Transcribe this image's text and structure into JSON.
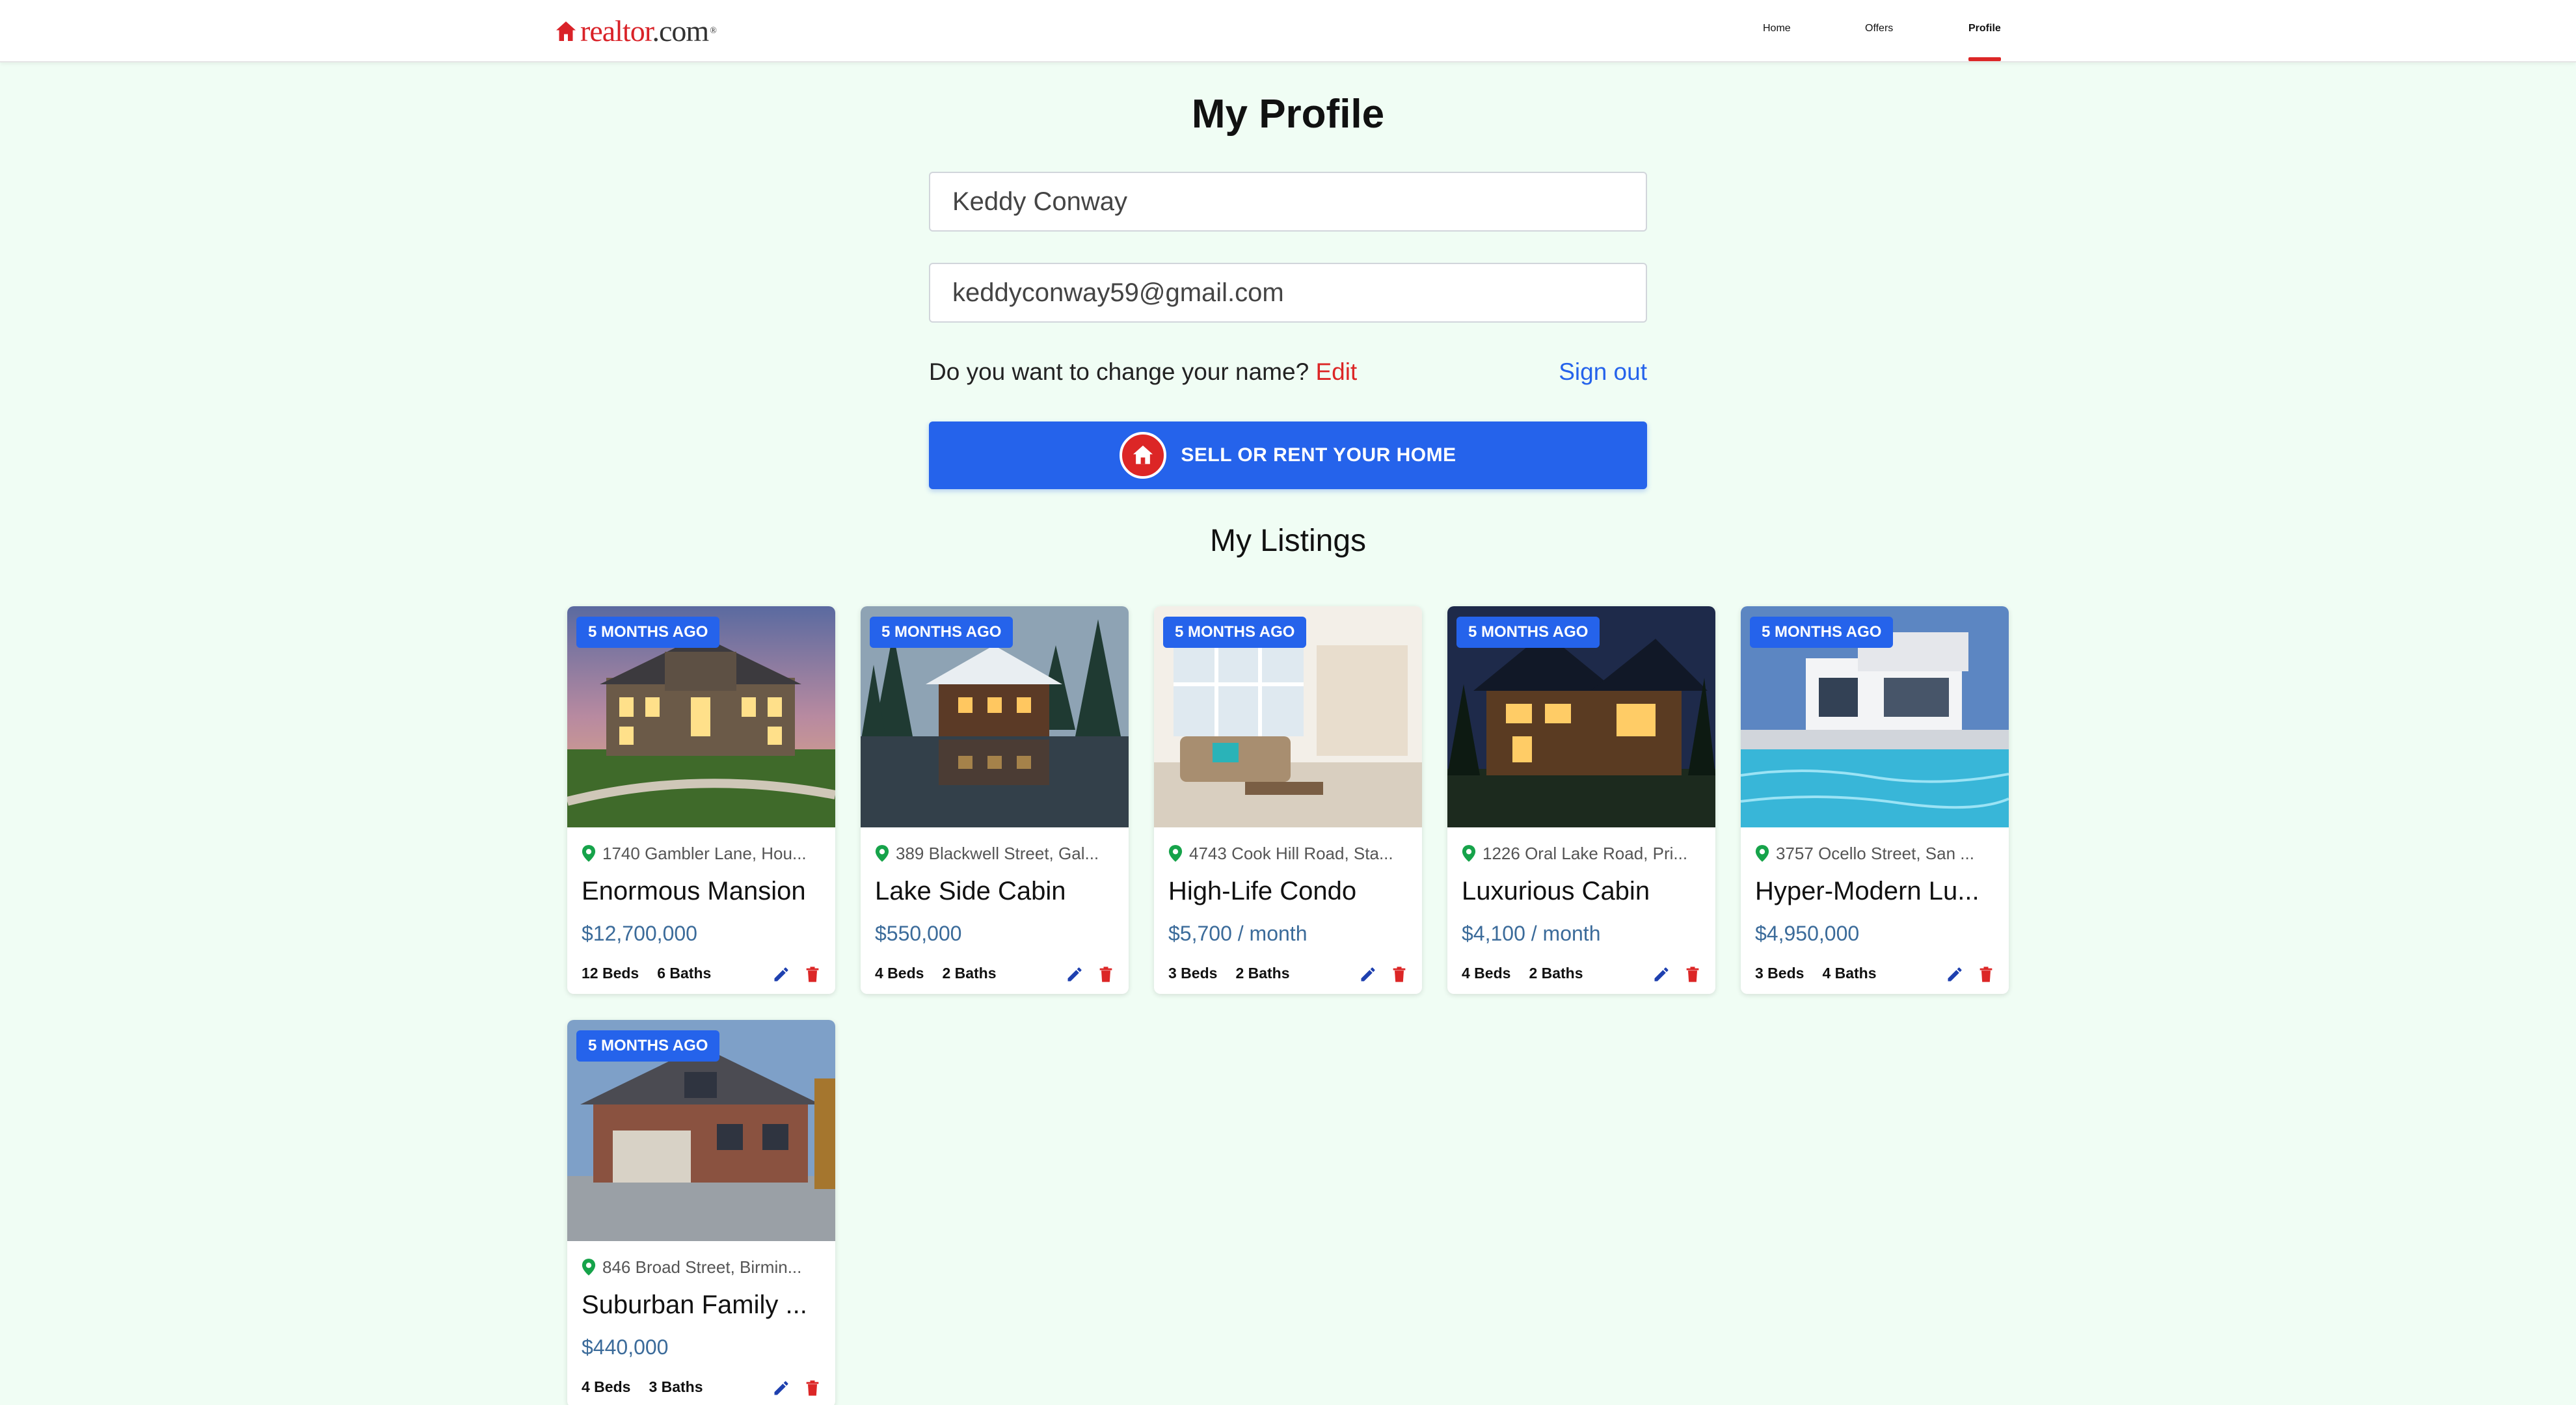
{
  "colors": {
    "accent": "#2563eb",
    "brand_red": "#dc2626",
    "background": "#f0fdf4",
    "price": "#3b6b9a"
  },
  "header": {
    "logo": {
      "word1": "realtor",
      "word2": ".com"
    },
    "nav": [
      {
        "label": "Home"
      },
      {
        "label": "Offers"
      },
      {
        "label": "Profile",
        "active": true
      }
    ]
  },
  "profile": {
    "title": "My Profile",
    "name_value": "Keddy Conway",
    "email_value": "keddyconway59@gmail.com",
    "change_question": "Do you want to change your name?",
    "edit_label": "Edit",
    "sign_out_label": "Sign out",
    "sell_button_label": "SELL OR RENT YOUR HOME",
    "sell_button_icon": "house-icon"
  },
  "listings": {
    "title": "My Listings",
    "items": [
      {
        "badge": "5 MONTHS AGO",
        "address": "1740 Gambler Lane, Hou...",
        "title": "Enormous Mansion",
        "price": "$12,700,000",
        "beds": "12 Beds",
        "baths": "6 Baths"
      },
      {
        "badge": "5 MONTHS AGO",
        "address": "389 Blackwell Street, Gal...",
        "title": "Lake Side Cabin",
        "price": "$550,000",
        "beds": "4 Beds",
        "baths": "2 Baths"
      },
      {
        "badge": "5 MONTHS AGO",
        "address": "4743 Cook Hill Road, Sta...",
        "title": "High-Life Condo",
        "price": "$5,700 / month",
        "beds": "3 Beds",
        "baths": "2 Baths"
      },
      {
        "badge": "5 MONTHS AGO",
        "address": "1226 Oral Lake Road, Pri...",
        "title": "Luxurious Cabin",
        "price": "$4,100 / month",
        "beds": "4 Beds",
        "baths": "2 Baths"
      },
      {
        "badge": "5 MONTHS AGO",
        "address": "3757 Ocello Street, San ...",
        "title": "Hyper-Modern Lu...",
        "price": "$4,950,000",
        "beds": "3 Beds",
        "baths": "4 Baths"
      },
      {
        "badge": "5 MONTHS AGO",
        "address": "846 Broad Street, Birmin...",
        "title": "Suburban Family ...",
        "price": "$440,000",
        "beds": "4 Beds",
        "baths": "3 Baths"
      }
    ]
  }
}
